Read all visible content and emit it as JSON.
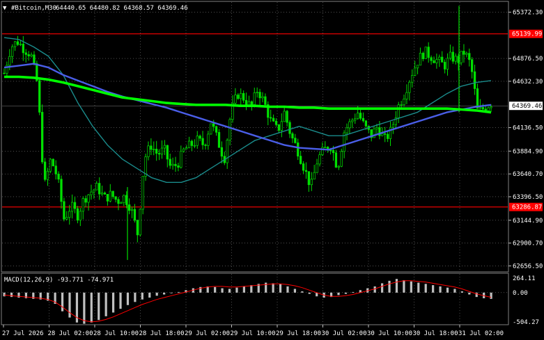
{
  "header": {
    "arrow": "▼",
    "symbol": "#Bitcoin,M30",
    "ohlc": "64440.65 64480.82 64368.57 64369.46"
  },
  "macd_panel": {
    "label": "MACD(12,26,9) -93.771 -74.971"
  },
  "colors": {
    "background": "#000000",
    "grid": "#808080",
    "candle_bull": "#00e000",
    "candle_bear": "#00e000",
    "ma_fast": "#1a8c8c",
    "ma_mid": "#4a5ee8",
    "ma_slow": "#00ff00",
    "hline": "#ff0000",
    "macd_hist": "#c0c0c0",
    "macd_signal": "#ff0000",
    "price_tag_bg": "#ffffff",
    "price_tag_text": "#000000",
    "hline_tag_bg": "#ff0000"
  },
  "chart_data": [
    {
      "type": "candlestick",
      "title": "#Bitcoin,M30",
      "ylim": [
        62600,
        65480
      ],
      "price_ticks": [
        "65372.30",
        "64876.50",
        "64632.30",
        "64136.50",
        "63884.90",
        "63640.70",
        "63396.50",
        "63144.90",
        "62900.70",
        "62656.50"
      ],
      "current_price": "64369.46",
      "horizontal_lines": [
        {
          "label": "65139.99",
          "value": 65139.99
        },
        {
          "label": "63286.87",
          "value": 63286.87
        }
      ],
      "time_labels": [
        "27 Jul 2026",
        "28 Jul 02:00",
        "28 Jul 10:00",
        "28 Jul 18:00",
        "29 Jul 02:00",
        "29 Jul 10:00",
        "29 Jul 18:00",
        "30 Jul 02:00",
        "30 Jul 10:00",
        "30 Jul 18:00",
        "31 Jul 02:00"
      ],
      "price_path": [
        64720,
        65000,
        65060,
        64980,
        64920,
        64600,
        63500,
        63800,
        63600,
        63150,
        63300,
        63200,
        63380,
        63450,
        63500,
        63380,
        63420,
        63350,
        63400,
        63280,
        63000,
        63800,
        63950,
        63850,
        63900,
        63700,
        63750,
        63900,
        63950,
        64000,
        63950,
        64200,
        64000,
        63800,
        64300,
        64500,
        64450,
        64350,
        64550,
        64400,
        64200,
        64100,
        64300,
        64050,
        63900,
        63700,
        63500,
        63800,
        63900,
        63950,
        63700,
        64100,
        64200,
        64300,
        64150,
        64050,
        64150,
        64000,
        64100,
        64350,
        64500,
        64700,
        64850,
        64950,
        64900,
        64850,
        64800,
        64900,
        64850,
        64950,
        64800,
        64300,
        64350,
        64400
      ],
      "ma_fast_path": [
        65100,
        65080,
        65000,
        64900,
        64700,
        64400,
        64150,
        63950,
        63800,
        63700,
        63600,
        63550,
        63550,
        63600,
        63700,
        63800,
        63900,
        64000,
        64050,
        64100,
        64150,
        64100,
        64050,
        64050,
        64100,
        64150,
        64200,
        64250,
        64300,
        64400,
        64500,
        64580,
        64620,
        64640
      ],
      "ma_mid_path": [
        64780,
        64800,
        64820,
        64780,
        64700,
        64640,
        64580,
        64520,
        64470,
        64430,
        64390,
        64350,
        64300,
        64250,
        64200,
        64150,
        64100,
        64050,
        64000,
        63950,
        63920,
        63910,
        63900,
        63950,
        64000,
        64050,
        64100,
        64150,
        64200,
        64250,
        64300,
        64330,
        64360,
        64380
      ],
      "ma_slow_path": [
        64680,
        64680,
        64670,
        64650,
        64620,
        64580,
        64540,
        64500,
        64460,
        64440,
        64420,
        64400,
        64390,
        64380,
        64380,
        64380,
        64370,
        64370,
        64360,
        64360,
        64350,
        64350,
        64340,
        64340,
        64340,
        64340,
        64340,
        64340,
        64340,
        64340,
        64340,
        64330,
        64320,
        64300
      ]
    },
    {
      "type": "bar",
      "title": "MACD(12,26,9) -93.771 -74.971",
      "ylim": [
        -504.27,
        300
      ],
      "ticks": [
        "264.11",
        "0.00",
        "-504.27"
      ],
      "histogram": [
        -60,
        -70,
        -80,
        -90,
        -100,
        -110,
        -130,
        -180,
        -300,
        -400,
        -480,
        -500,
        -480,
        -440,
        -380,
        -320,
        -260,
        -200,
        -150,
        -110,
        -80,
        -50,
        -30,
        -10,
        10,
        40,
        70,
        90,
        100,
        90,
        70,
        60,
        80,
        100,
        120,
        140,
        160,
        150,
        140,
        100,
        60,
        20,
        -20,
        -60,
        -80,
        -70,
        -40,
        -20,
        10,
        40,
        70,
        100,
        150,
        190,
        220,
        200,
        180,
        160,
        140,
        120,
        100,
        80,
        60,
        20,
        -30,
        -70,
        -90,
        -100
      ],
      "signal": [
        -40,
        -50,
        -60,
        -70,
        -80,
        -90,
        -110,
        -150,
        -230,
        -320,
        -400,
        -450,
        -470,
        -460,
        -430,
        -390,
        -340,
        -290,
        -240,
        -190,
        -150,
        -110,
        -80,
        -50,
        -20,
        10,
        40,
        70,
        90,
        100,
        100,
        90,
        90,
        100,
        110,
        120,
        130,
        140,
        140,
        130,
        110,
        80,
        40,
        0,
        -40,
        -60,
        -60,
        -50,
        -30,
        0,
        30,
        60,
        100,
        140,
        170,
        190,
        190,
        180,
        170,
        150,
        130,
        110,
        90,
        60,
        20,
        -20,
        -50,
        -75
      ]
    }
  ]
}
